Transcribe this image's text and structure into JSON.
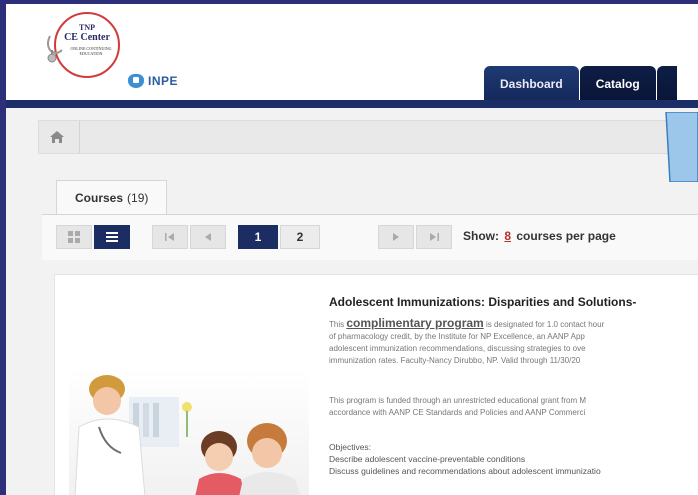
{
  "logo": {
    "line1": "TNP",
    "line2": "CE Center",
    "line3": "ONLINE CONTINUING EDUCATION",
    "partner": "INPE"
  },
  "nav": {
    "tabs": [
      {
        "label": "Dashboard"
      },
      {
        "label": "Catalog"
      }
    ]
  },
  "tabs": {
    "courses_label": "Courses",
    "courses_count": "(19)"
  },
  "pagination": {
    "pages": [
      "1",
      "2"
    ],
    "current": "1",
    "show_prefix": "Show:",
    "show_value": "8",
    "show_suffix": "courses per page"
  },
  "course": {
    "title": "Adolescent Immunizations: Disparities and Solutions-",
    "desc_pre": "This ",
    "desc_link": "complimentary program",
    "desc_post": " is designated for 1.0 contact hour",
    "desc_line2": "of pharmacology credit, by the Institute for NP Excellence, an AANP App",
    "desc_line3": "adolescent immunization recommendations, discussing strategies to ove",
    "desc_line4": "immunization rates.  Faculty-Nancy Dirubbo, NP. Valid through 11/30/20",
    "fund_line1": "This program is funded through an unrestricted educational grant from M",
    "fund_line2": "accordance with AANP CE Standards and Policies and AANP Commerci",
    "objectives_label": "Objectives:",
    "objective1": "Describe adolescent vaccine-preventable conditions",
    "objective2": "Discuss guidelines and recommendations about adolescent immunizatio"
  },
  "colors": {
    "nav_bg": "#14285a",
    "accent": "#1c2d63",
    "show_value": "#b8312f"
  }
}
